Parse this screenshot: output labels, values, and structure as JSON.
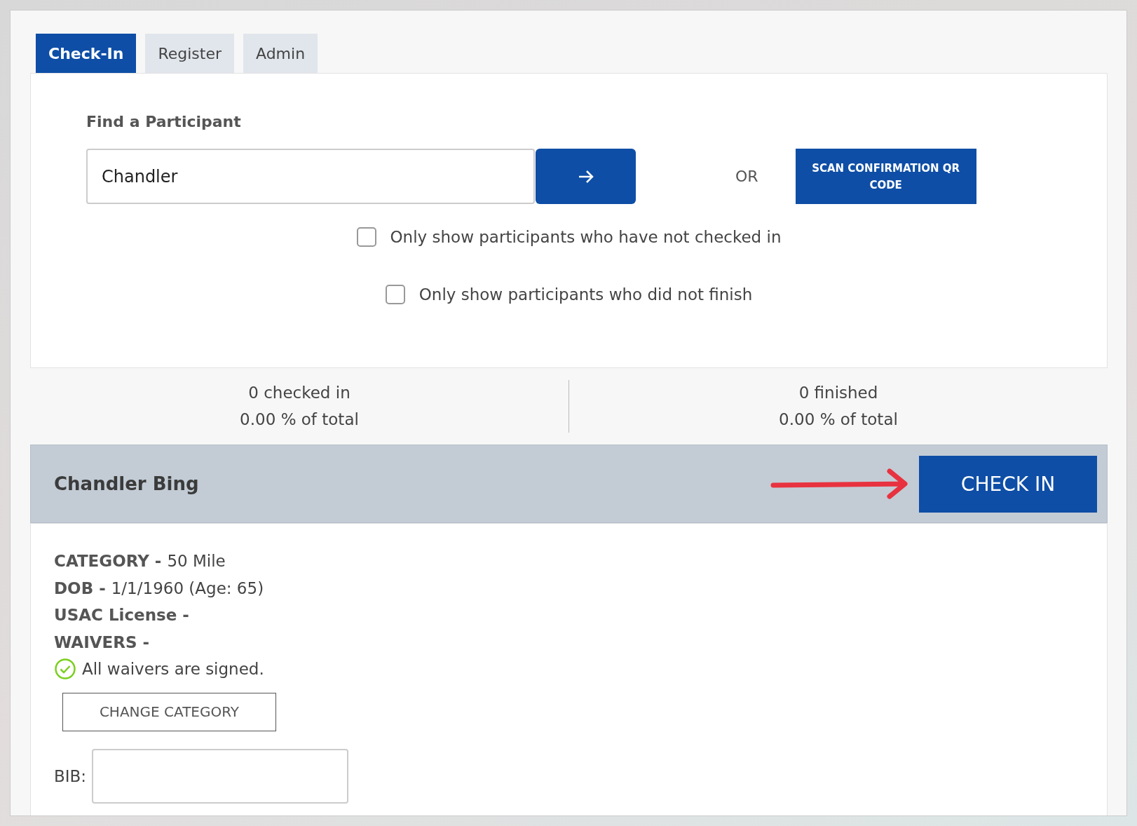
{
  "tabs": [
    {
      "label": "Check-In",
      "selected": true
    },
    {
      "label": "Register",
      "selected": false
    },
    {
      "label": "Admin",
      "selected": false
    }
  ],
  "search": {
    "label": "Find a Participant",
    "value": "Chandler"
  },
  "or_text": "OR",
  "scan_button": "SCAN CONFIRMATION QR CODE",
  "filters": [
    {
      "label": "Only show participants who have not checked in",
      "checked": false
    },
    {
      "label": "Only show participants who did not finish",
      "checked": false
    }
  ],
  "stats": [
    {
      "count": "0 checked in",
      "percent": "0.00 % of total"
    },
    {
      "count": "0 finished",
      "percent": "0.00 % of total"
    }
  ],
  "participant": {
    "name": "Chandler Bing",
    "check_in_button": "CHECK IN",
    "details": [
      {
        "label": "CATEGORY -",
        "value": "50 Mile"
      },
      {
        "label": "DOB -",
        "value": "1/1/1960 (Age: 65)"
      },
      {
        "label": "USAC License -"
      },
      {
        "label": "WAIVERS -"
      }
    ],
    "waivers": {
      "signed": true,
      "text": "All waivers are signed."
    },
    "change_category_button": "CHANGE CATEGORY",
    "bib_label": "BIB:"
  }
}
